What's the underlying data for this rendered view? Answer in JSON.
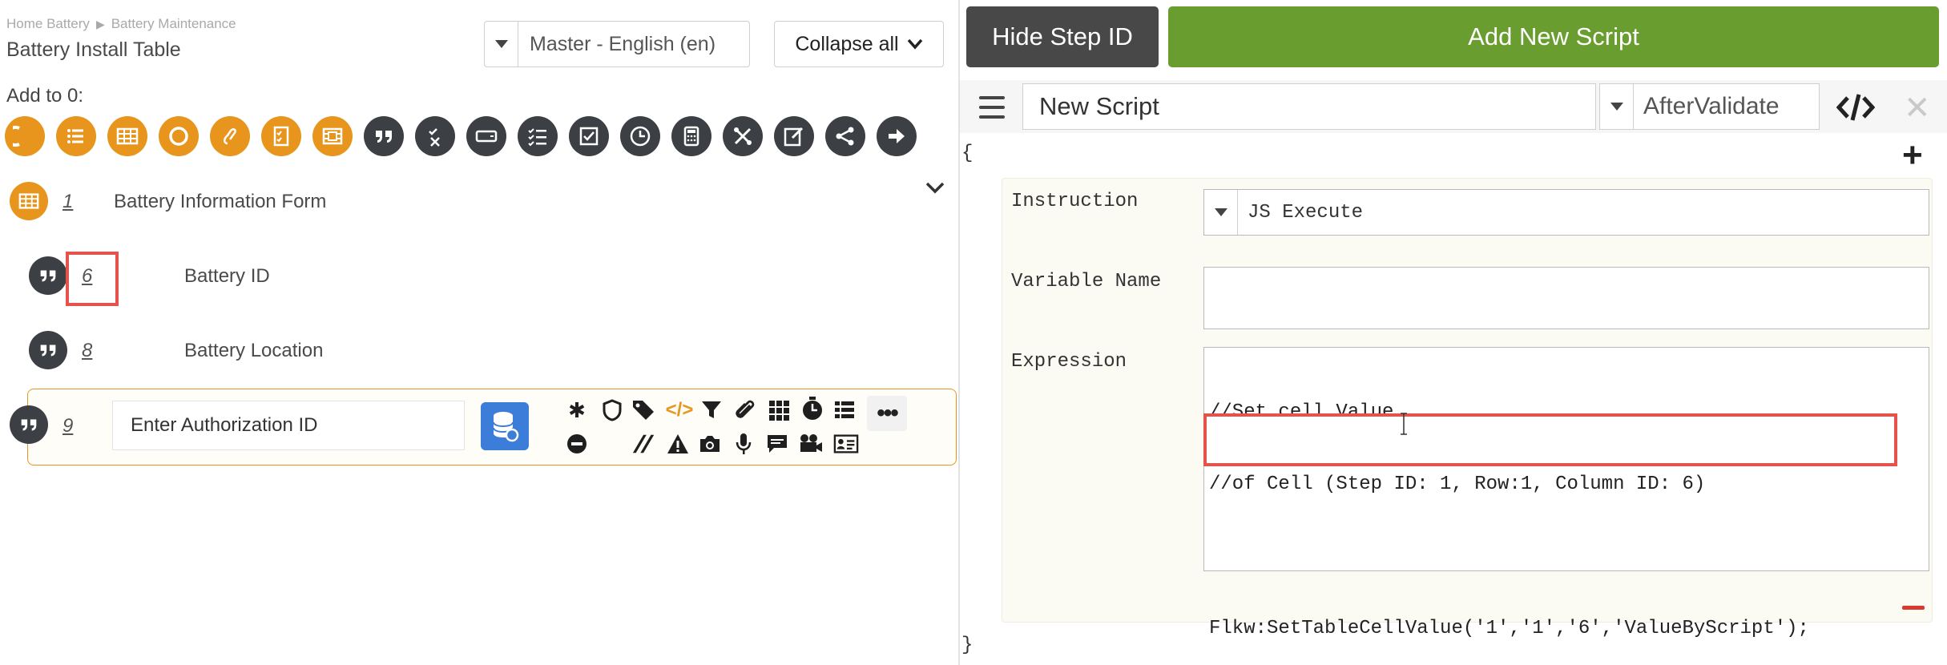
{
  "left": {
    "breadcrumb": [
      "Home Battery",
      "Battery Maintenance"
    ],
    "breadcrumb_separator": "▶",
    "title": "Battery Install Table",
    "language_select": {
      "value": "Master - English (en)"
    },
    "collapse_button": {
      "label": "Collapse all"
    },
    "add_to_label": "Add to 0:",
    "toolbar_icons": [
      {
        "name": "partial-circle-icon",
        "color": "orange"
      },
      {
        "name": "list-icon",
        "color": "orange"
      },
      {
        "name": "table-icon",
        "color": "orange"
      },
      {
        "name": "ring-icon",
        "color": "orange"
      },
      {
        "name": "link-icon",
        "color": "orange"
      },
      {
        "name": "checklist-icon",
        "color": "orange"
      },
      {
        "name": "film-icon",
        "color": "orange"
      },
      {
        "name": "quote-icon",
        "color": "dark"
      },
      {
        "name": "check-x-icon",
        "color": "dark"
      },
      {
        "name": "card-icon",
        "color": "dark"
      },
      {
        "name": "multi-check-icon",
        "color": "dark"
      },
      {
        "name": "checkbox-icon",
        "color": "dark"
      },
      {
        "name": "clock-icon",
        "color": "dark"
      },
      {
        "name": "calculator-icon",
        "color": "dark"
      },
      {
        "name": "tools-icon",
        "color": "dark"
      },
      {
        "name": "edit-icon",
        "color": "dark"
      },
      {
        "name": "share-icon",
        "color": "dark"
      },
      {
        "name": "arrow-right-icon",
        "color": "dark"
      }
    ],
    "steps": [
      {
        "num": "1",
        "label": "Battery Information Form"
      },
      {
        "num": "6",
        "label": "Battery ID"
      },
      {
        "num": "8",
        "label": "Battery Location"
      },
      {
        "num": "9",
        "input_value": "Enter Authorization ID"
      }
    ],
    "more_label": "•••"
  },
  "right": {
    "hide_step_id_label": "Hide Step ID",
    "add_new_script_label": "Add New Script",
    "script_name": "New Script",
    "event_select": "AfterValidate",
    "close_label": "✕",
    "open_brace": "{",
    "close_brace": "}",
    "plus_label": "+",
    "instruction_label": "Instruction",
    "instruction_value": "JS Execute",
    "variable_name_label": "Variable Name",
    "variable_name_value": "",
    "expression_label": "Expression",
    "expression_lines": [
      "//Set cell Value",
      "//of Cell (Step ID: 1, Row:1, Column ID: 6)",
      "",
      "Flkw:SetTableCellValue('1','1','6','ValueByScript');"
    ]
  },
  "colors": {
    "orange": "#e8951e",
    "dark_icon": "#3c3f44",
    "green_button": "#6a9d2f",
    "dark_button": "#484848",
    "highlight_red": "#e5534b",
    "db_blue": "#3b7dd8"
  }
}
